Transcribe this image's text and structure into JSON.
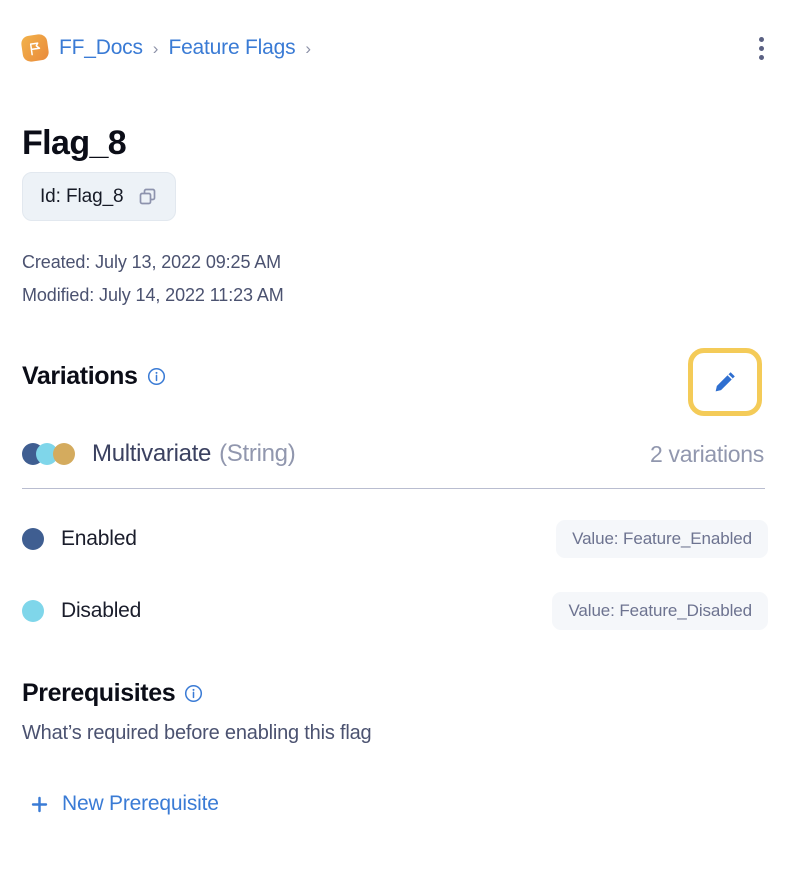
{
  "breadcrumb": {
    "app_icon": "flag-app-icon",
    "items": [
      {
        "label": "FF_Docs"
      },
      {
        "label": "Feature Flags"
      }
    ],
    "separator": "›",
    "overflow_menu_icon": "kebab-menu-icon"
  },
  "flag": {
    "title": "Flag_8",
    "id_chip_label": "Id: Flag_8",
    "copy_icon": "copy-icon",
    "created": "Created: July 13, 2022 09:25 AM",
    "modified": "Modified: July 14, 2022 11:23 AM"
  },
  "variations": {
    "section_title": "Variations",
    "info_icon": "info-icon",
    "edit_icon": "pencil-edit-icon",
    "type_name": "Multivariate",
    "type_kind": "(String)",
    "count_label": "2 variations",
    "dot_colors": [
      "#3f5e91",
      "#7fd6ea",
      "#d4ab5e"
    ],
    "rows": [
      {
        "label": "Enabled",
        "dot_color": "#3f5e91",
        "value_label": "Value: Feature_Enabled"
      },
      {
        "label": "Disabled",
        "dot_color": "#7fd6ea",
        "value_label": "Value: Feature_Disabled"
      }
    ]
  },
  "prerequisites": {
    "section_title": "Prerequisites",
    "info_icon": "info-icon",
    "subtitle": "What’s required before enabling this flag",
    "add_label": "New Prerequisite",
    "plus_icon": "plus-icon"
  },
  "colors": {
    "link_blue": "#3a7bd5",
    "highlight_yellow": "#f4cb58",
    "text_dark": "#0b0d17",
    "text_muted": "#4b5270",
    "pill_bg": "#f5f7fa",
    "chip_bg": "#edf2f7"
  }
}
